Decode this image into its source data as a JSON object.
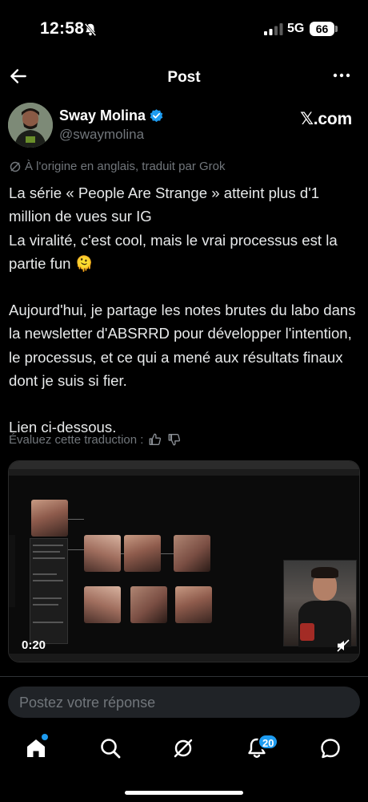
{
  "status_bar": {
    "time": "12:58",
    "network": "5G",
    "battery": "66"
  },
  "header": {
    "title": "Post"
  },
  "author": {
    "name": "Sway Molina",
    "handle": "@swaymolina",
    "source": "𝕏.com",
    "verified": true
  },
  "post": {
    "translation_note": "À l'origine en anglais, traduit par Grok",
    "paragraphs": [
      "La série « People Are Strange » atteint plus d'1 million de vues sur IG\nLa viralité, c'est cool, mais le vrai processus est la partie fun 🫠",
      "Aujourd'hui, je partage les notes brutes du labo dans la newsletter d'ABSRRD pour développer l'intention, le processus, et ce qui a mené aux résultats finaux dont je suis si fier.",
      "Lien ci-dessous."
    ],
    "rate_translation": "Évaluez cette traduction :"
  },
  "video": {
    "duration": "0:20"
  },
  "reply": {
    "placeholder": "Postez votre réponse"
  },
  "nav": {
    "notifications_badge": "20"
  },
  "colors": {
    "accent": "#1d9bf0",
    "background": "#000000",
    "text": "#e7e9ea",
    "muted": "#71767b"
  }
}
